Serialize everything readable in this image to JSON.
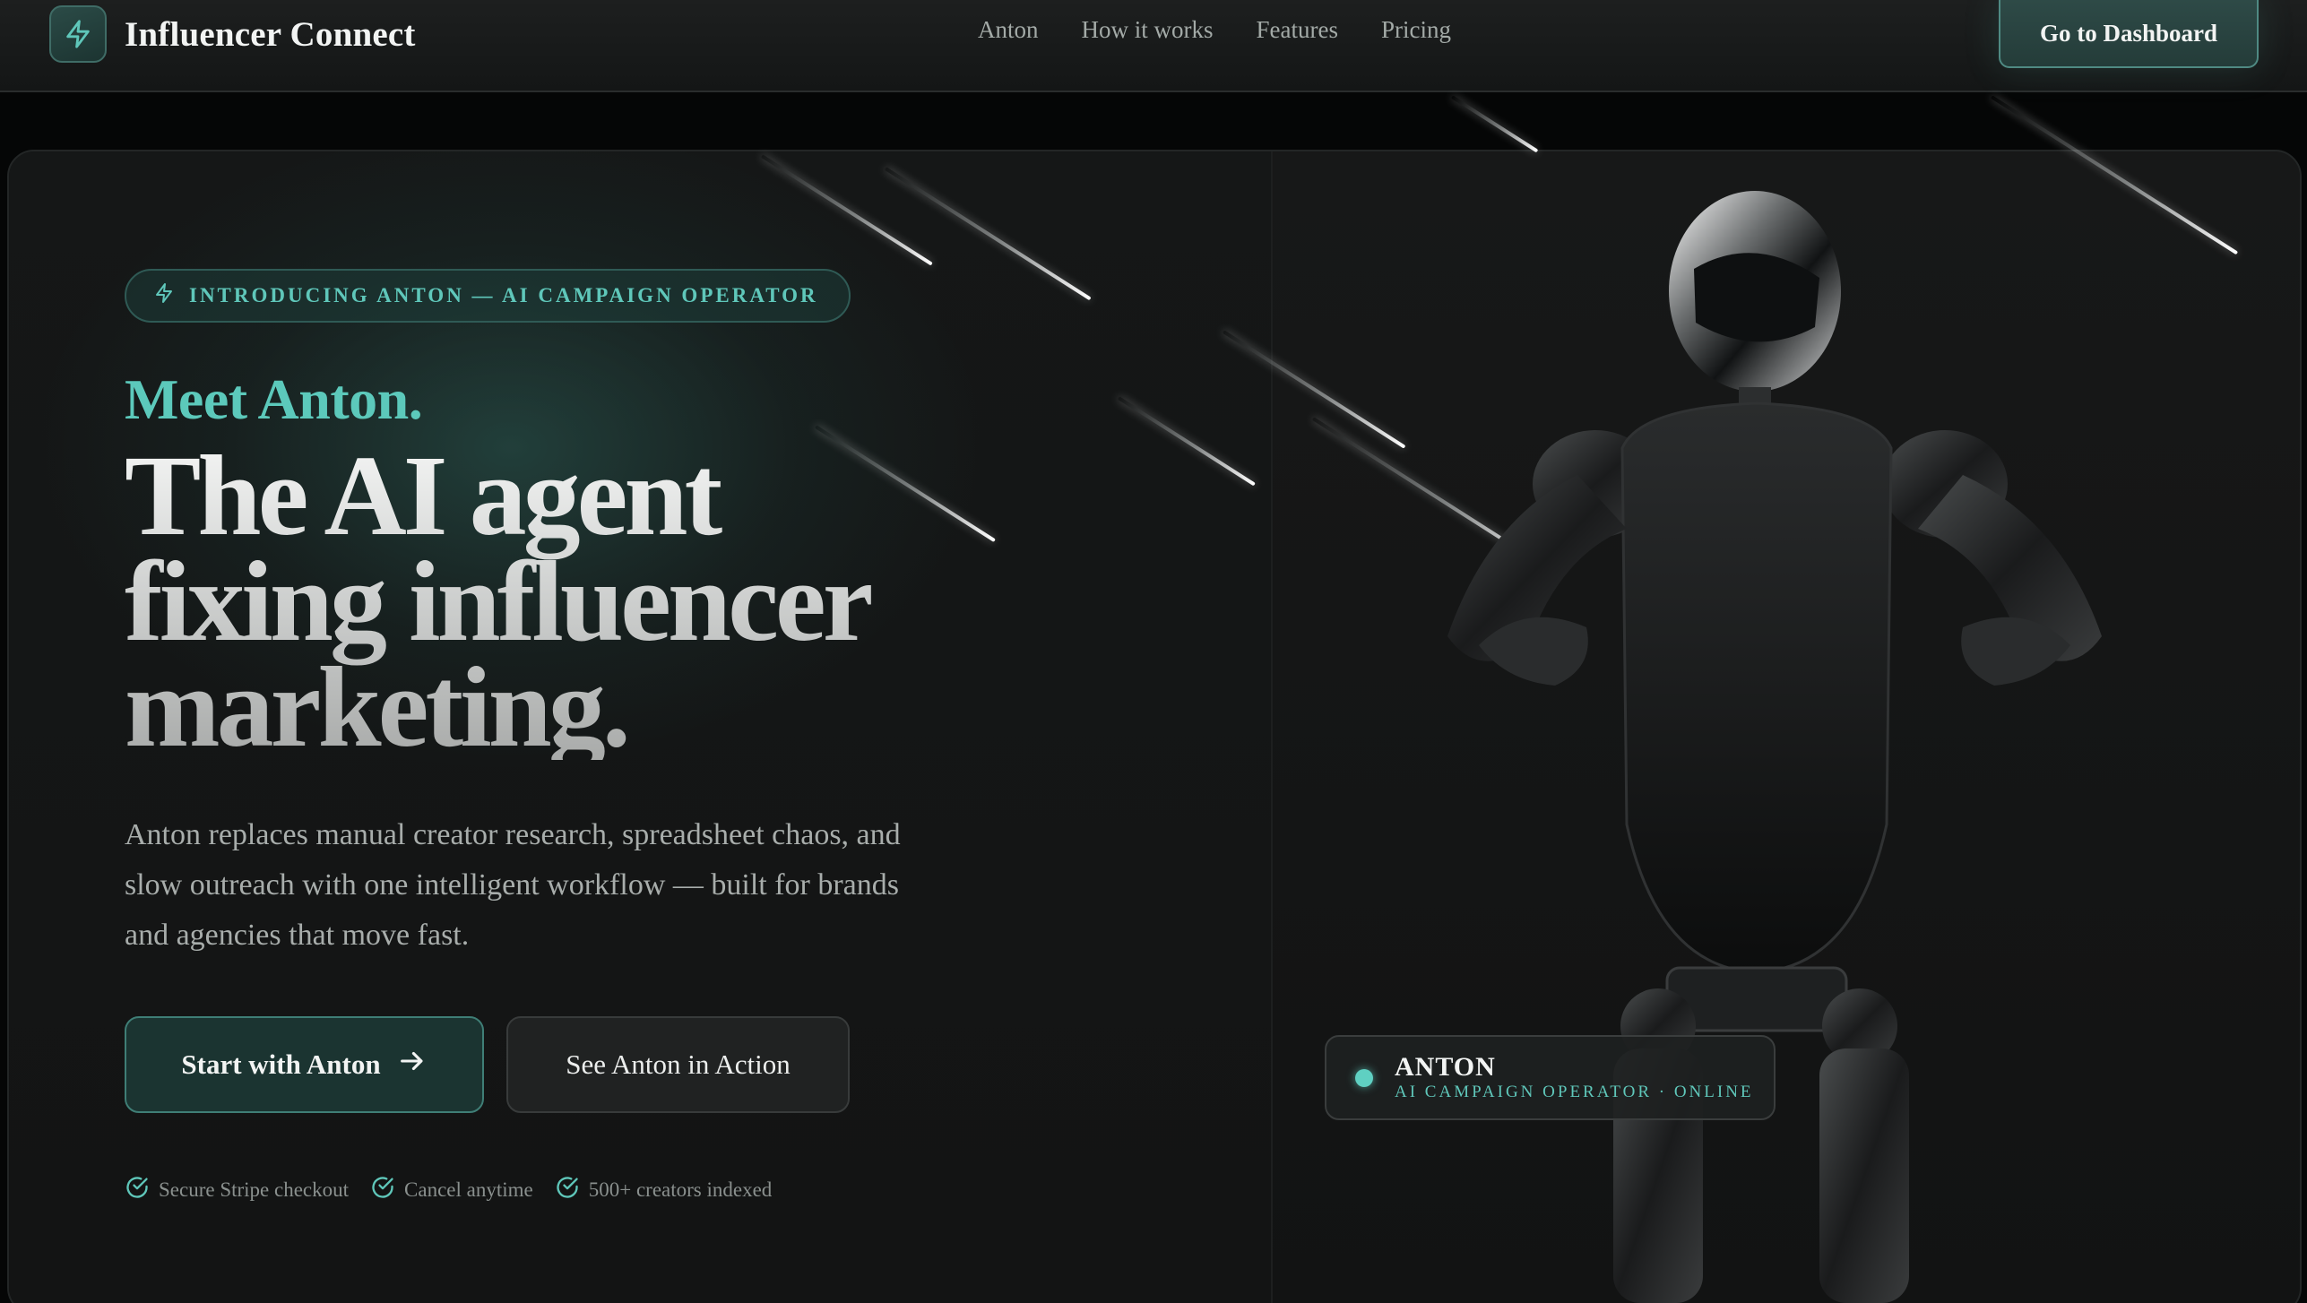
{
  "nav": {
    "brand_name": "Influencer Connect",
    "brand_icon": "lightning-bolt-icon",
    "links": [
      "Anton",
      "How it works",
      "Features",
      "Pricing"
    ],
    "dashboard_label": "Go to Dashboard"
  },
  "hero": {
    "badge": "INTRODUCING ANTON — AI CAMPAIGN OPERATOR",
    "badge_icon": "lightning-bolt-icon",
    "eyebrow": "Meet Anton.",
    "headline_line1": "The AI agent",
    "headline_line2": "fixing influencer",
    "headline_line3": "marketing.",
    "subtext": "Anton replaces manual creator research, spreadsheet chaos, and slow outreach with one intelligent workflow — built for brands and agencies that move fast.",
    "primary_cta": "Start with Anton",
    "primary_cta_icon": "arrow-right-icon",
    "secondary_cta": "See Anton in Action",
    "trust_items": [
      "Secure Stripe checkout",
      "Cancel anytime",
      "500+ creators indexed"
    ],
    "trust_icon": "check-circle-icon"
  },
  "status": {
    "name": "ANTON",
    "role": "AI CAMPAIGN OPERATOR · ONLINE"
  },
  "colors": {
    "accent": "#5fc7ba",
    "primary_button": "#1b3431",
    "background": "#141515"
  }
}
